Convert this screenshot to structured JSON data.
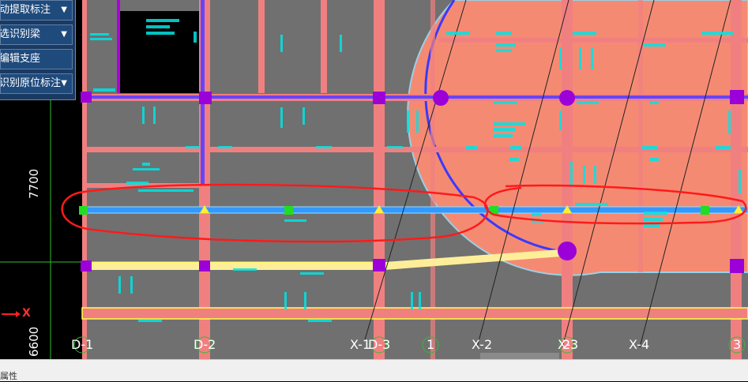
{
  "side_panel": {
    "items": [
      {
        "label": "动提取标注",
        "has_dropdown": true
      },
      {
        "label": "选识别梁",
        "has_dropdown": true
      },
      {
        "label": "编辑支座",
        "has_dropdown": false
      },
      {
        "label": "识别原位标注",
        "has_dropdown": true
      }
    ],
    "dropdown_glyph": "▼"
  },
  "dimensions": {
    "upper": "7700",
    "lower": "6600"
  },
  "axis_indicator": {
    "label": "X",
    "arrow_color": "#ff2020"
  },
  "grid_axes": [
    {
      "label": "D-1"
    },
    {
      "label": "D-2"
    },
    {
      "label": "X-1"
    },
    {
      "label": "D-3"
    },
    {
      "label": "1"
    },
    {
      "label": "X-2"
    },
    {
      "label": "X-3"
    },
    {
      "label": "2"
    },
    {
      "label": "X-4"
    },
    {
      "label": "3"
    }
  ],
  "status_bar": {
    "text": "属性"
  },
  "colors": {
    "slab": "#707070",
    "beam_pink": "#f08080",
    "circle_slab": "#f58a73",
    "column": "#9c00d8",
    "selected_beam": "#3399ff",
    "highlight_loop": "#ff1a1a",
    "support_green": "#22dd22",
    "support_yellow": "#ffee33",
    "cad_text": "#00e5e5"
  }
}
